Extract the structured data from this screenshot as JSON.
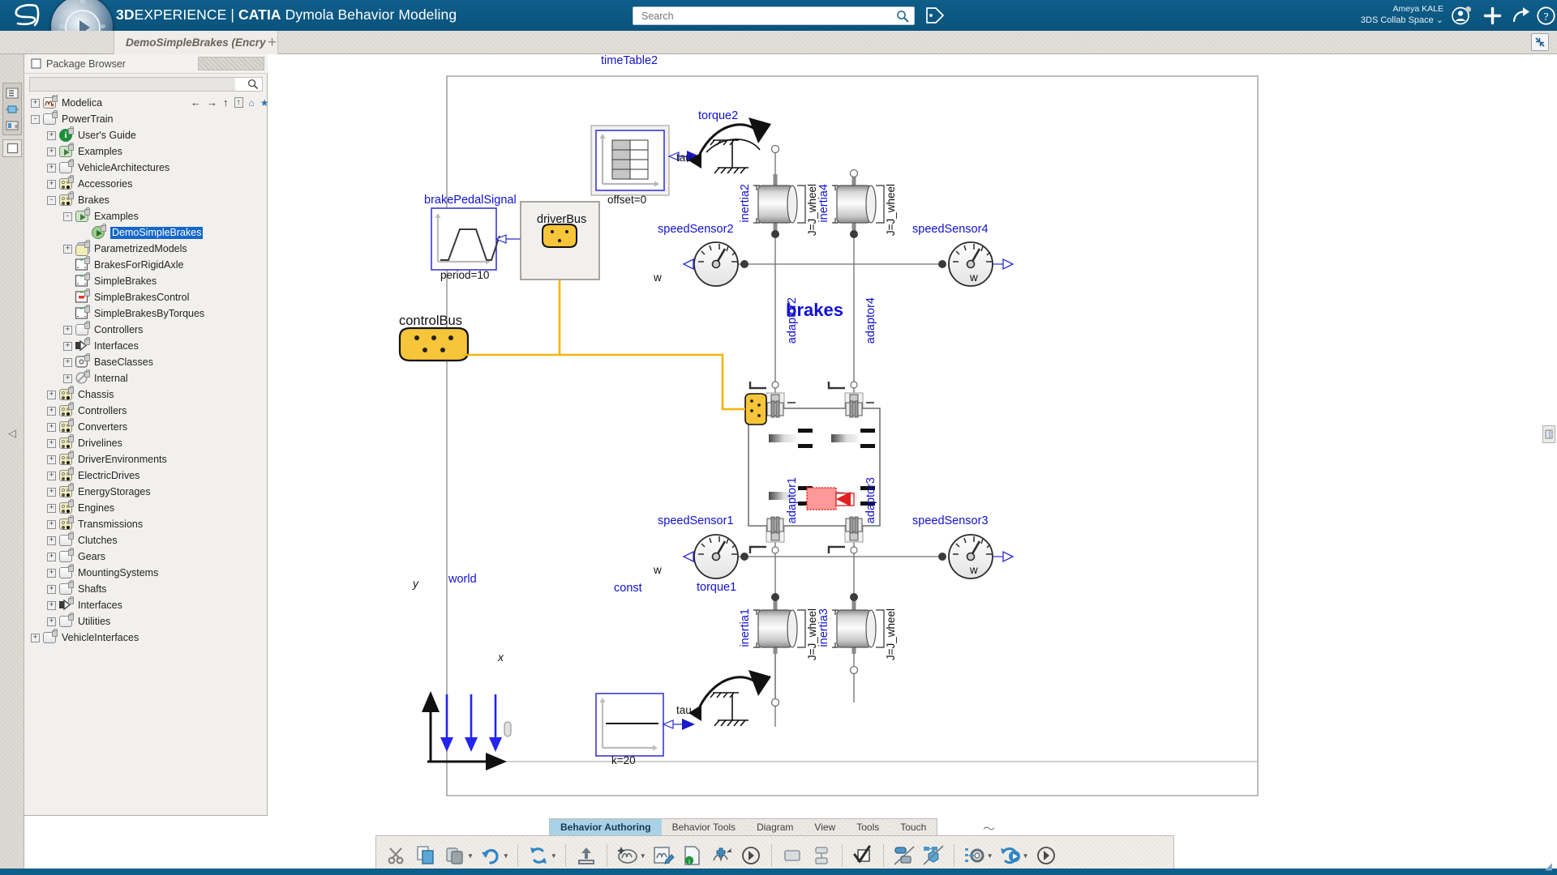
{
  "topbar": {
    "brand_3d": "3D",
    "brand_experience": "EXPERIENCE",
    "brand_sep": "|",
    "brand_catia": "CATIA",
    "brand_app": "Dymola Behavior Modeling",
    "search_placeholder": "Search",
    "search_value": "",
    "user_name": "Ameya KALE",
    "user_space": "3DS Collab Space",
    "icons": {
      "search": "search-icon",
      "tag": "tag-icon",
      "user": "user-account-icon",
      "plus": "add-icon",
      "share": "share-icon",
      "help": "help-icon",
      "compass": "3dexperience-compass-icon",
      "logo": "3ds-logo-icon"
    }
  },
  "tabrow": {
    "doc_tab": "DemoSimpleBrakes (Encry",
    "add_tab": "+",
    "collapse": "collapse-icon"
  },
  "browser": {
    "title": "Package Browser",
    "filter_value": "",
    "nav_icons": [
      "back-arrow-icon",
      "forward-arrow-icon",
      "up-arrow-icon",
      "up-level-icon",
      "home-icon",
      "star-icon"
    ],
    "tree": [
      {
        "label": "Modelica",
        "depth": 0,
        "expander": "+",
        "icon": "modelica-icon",
        "selected": false
      },
      {
        "label": "PowerTrain",
        "depth": 0,
        "expander": "-",
        "icon": "package-plain-icon",
        "selected": false
      },
      {
        "label": "User's Guide",
        "depth": 1,
        "expander": "+",
        "icon": "info-icon",
        "selected": false
      },
      {
        "label": "Examples",
        "depth": 1,
        "expander": "+",
        "icon": "example-icon",
        "selected": false
      },
      {
        "label": "VehicleArchitectures",
        "depth": 1,
        "expander": "+",
        "icon": "package-plain-icon",
        "selected": false
      },
      {
        "label": "Accessories",
        "depth": 1,
        "expander": "+",
        "icon": "package-dots-icon",
        "selected": false
      },
      {
        "label": "Brakes",
        "depth": 1,
        "expander": "-",
        "icon": "package-dots-icon",
        "selected": false
      },
      {
        "label": "Examples",
        "depth": 2,
        "expander": "-",
        "icon": "example-icon",
        "selected": false
      },
      {
        "label": "DemoSimpleBrakes",
        "depth": 3,
        "expander": "",
        "icon": "model-run-icon",
        "selected": true
      },
      {
        "label": "ParametrizedModels",
        "depth": 2,
        "expander": "+",
        "icon": "parametrized-icon",
        "selected": false
      },
      {
        "label": "BrakesForRigidAxle",
        "depth": 2,
        "expander": "",
        "icon": "model-icon",
        "selected": false
      },
      {
        "label": "SimpleBrakes",
        "depth": 2,
        "expander": "",
        "icon": "model-icon",
        "selected": false
      },
      {
        "label": "SimpleBrakesControl",
        "depth": 2,
        "expander": "",
        "icon": "model-red-icon",
        "selected": false
      },
      {
        "label": "SimpleBrakesByTorques",
        "depth": 2,
        "expander": "",
        "icon": "model-icon",
        "selected": false
      },
      {
        "label": "Controllers",
        "depth": 2,
        "expander": "+",
        "icon": "package-plain-icon",
        "selected": false
      },
      {
        "label": "Interfaces",
        "depth": 2,
        "expander": "+",
        "icon": "interface-icon",
        "selected": false
      },
      {
        "label": "BaseClasses",
        "depth": 2,
        "expander": "+",
        "icon": "baseclass-icon",
        "selected": false
      },
      {
        "label": "Internal",
        "depth": 2,
        "expander": "+",
        "icon": "internal-icon",
        "selected": false
      },
      {
        "label": "Chassis",
        "depth": 1,
        "expander": "+",
        "icon": "package-dots-icon",
        "selected": false
      },
      {
        "label": "Controllers",
        "depth": 1,
        "expander": "+",
        "icon": "package-dots-icon",
        "selected": false
      },
      {
        "label": "Converters",
        "depth": 1,
        "expander": "+",
        "icon": "package-dots-icon",
        "selected": false
      },
      {
        "label": "Drivelines",
        "depth": 1,
        "expander": "+",
        "icon": "package-dots-icon",
        "selected": false
      },
      {
        "label": "DriverEnvironments",
        "depth": 1,
        "expander": "+",
        "icon": "package-dots-icon",
        "selected": false
      },
      {
        "label": "ElectricDrives",
        "depth": 1,
        "expander": "+",
        "icon": "package-dots-icon",
        "selected": false
      },
      {
        "label": "EnergyStorages",
        "depth": 1,
        "expander": "+",
        "icon": "package-dots-icon",
        "selected": false
      },
      {
        "label": "Engines",
        "depth": 1,
        "expander": "+",
        "icon": "package-dots-icon",
        "selected": false
      },
      {
        "label": "Transmissions",
        "depth": 1,
        "expander": "+",
        "icon": "package-dots-icon",
        "selected": false
      },
      {
        "label": "Clutches",
        "depth": 1,
        "expander": "+",
        "icon": "package-plain-icon",
        "selected": false
      },
      {
        "label": "Gears",
        "depth": 1,
        "expander": "+",
        "icon": "package-plain-icon",
        "selected": false
      },
      {
        "label": "MountingSystems",
        "depth": 1,
        "expander": "+",
        "icon": "package-plain-icon",
        "selected": false
      },
      {
        "label": "Shafts",
        "depth": 1,
        "expander": "+",
        "icon": "package-plain-icon",
        "selected": false
      },
      {
        "label": "Interfaces",
        "depth": 1,
        "expander": "+",
        "icon": "interface-icon",
        "selected": false
      },
      {
        "label": "Utilities",
        "depth": 1,
        "expander": "+",
        "icon": "package-plain-icon",
        "selected": false
      },
      {
        "label": "VehicleInterfaces",
        "depth": 0,
        "expander": "+",
        "icon": "package-plain-icon",
        "selected": false
      }
    ]
  },
  "diagram": {
    "components": [
      {
        "name": "timeTable2",
        "param": "offset=0",
        "kind": "timetable"
      },
      {
        "name": "torque2",
        "port": "tau",
        "kind": "torque"
      },
      {
        "name": "inertia2",
        "param": "J=J_wheel",
        "kind": "inertia"
      },
      {
        "name": "inertia4",
        "param": "J=J_wheel",
        "kind": "inertia"
      },
      {
        "name": "inertia1",
        "param": "J=J_wheel",
        "kind": "inertia"
      },
      {
        "name": "inertia3",
        "param": "J=J_wheel",
        "kind": "inertia"
      },
      {
        "name": "speedSensor2",
        "port": "w",
        "kind": "speedsensor"
      },
      {
        "name": "speedSensor4",
        "port": "w",
        "kind": "speedsensor"
      },
      {
        "name": "speedSensor1",
        "port": "w",
        "kind": "speedsensor"
      },
      {
        "name": "speedSensor3",
        "port": "w",
        "kind": "speedsensor"
      },
      {
        "name": "adaptor2",
        "kind": "adaptor"
      },
      {
        "name": "adaptor4",
        "kind": "adaptor"
      },
      {
        "name": "adaptor1",
        "kind": "adaptor"
      },
      {
        "name": "adaptor3",
        "kind": "adaptor"
      },
      {
        "name": "brakePedalSignal",
        "param": "period=10",
        "kind": "trapezoid"
      },
      {
        "name": "driverBus",
        "kind": "bus-box"
      },
      {
        "name": "controlBus",
        "kind": "bus-connector"
      },
      {
        "name": "brakes",
        "kind": "brakes-block"
      },
      {
        "name": "world",
        "kind": "world"
      },
      {
        "name": "const",
        "param": "k=20",
        "kind": "constant"
      },
      {
        "name": "torque1",
        "port": "tau",
        "kind": "torque"
      }
    ],
    "axis_labels": {
      "x": "x",
      "y": "y"
    },
    "colors": {
      "component_label": "#1111d0",
      "bus": "#f5b50a",
      "bus_line": "#f5b50a",
      "brake_red": "#ff8080"
    }
  },
  "actionbar": {
    "tabs": [
      {
        "label": "Behavior Authoring",
        "active": true
      },
      {
        "label": "Behavior Tools",
        "active": false
      },
      {
        "label": "Diagram",
        "active": false
      },
      {
        "label": "View",
        "active": false
      },
      {
        "label": "Tools",
        "active": false
      },
      {
        "label": "Touch",
        "active": false
      }
    ],
    "more": "more-tabs-icon",
    "buttons": [
      {
        "icon": "cut-icon",
        "dropdown": false
      },
      {
        "icon": "copy-icon",
        "dropdown": false
      },
      {
        "icon": "paste-icon",
        "dropdown": true
      },
      {
        "icon": "undo-icon",
        "dropdown": true
      },
      {
        "icon": "refresh-icon",
        "dropdown": true
      },
      {
        "icon": "export-icon",
        "dropdown": false
      },
      {
        "icon": "new-behavior-icon",
        "dropdown": true
      },
      {
        "icon": "edit-behavior-icon",
        "dropdown": false
      },
      {
        "icon": "document-info-icon",
        "dropdown": false
      },
      {
        "icon": "add-behavior-icon",
        "dropdown": false
      },
      {
        "icon": "run-arrow-icon",
        "dropdown": false
      },
      {
        "icon": "rectangle-icon",
        "dropdown": false
      },
      {
        "icon": "hierarchy-icon",
        "dropdown": false
      },
      {
        "icon": "check-shape-icon",
        "dropdown": false
      },
      {
        "icon": "connect-print-icon",
        "dropdown": false
      },
      {
        "icon": "ratio-cube-icon",
        "dropdown": false
      },
      {
        "icon": "settings-gear-icon",
        "dropdown": true
      },
      {
        "icon": "simulate-icon",
        "dropdown": true
      },
      {
        "icon": "next-arrow-icon",
        "dropdown": false
      }
    ]
  },
  "right_panel_btn": "right-panel-toggle-icon"
}
